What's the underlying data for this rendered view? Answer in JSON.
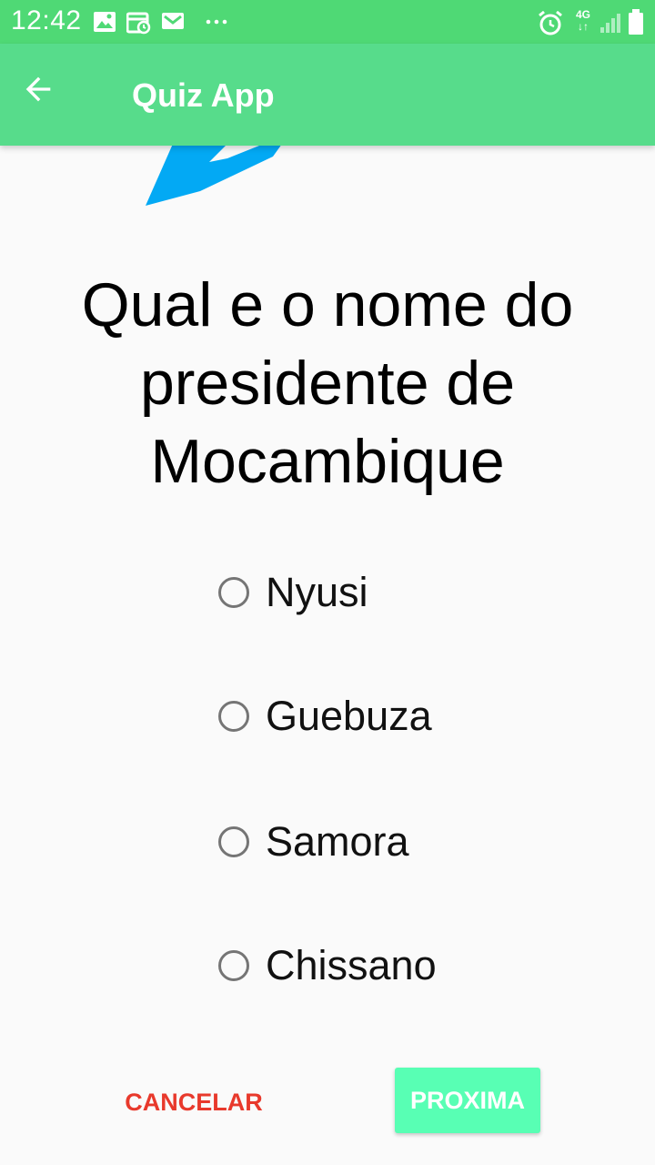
{
  "status_bar": {
    "time": "12:42",
    "left_icons": [
      "image-icon",
      "calendar-icon",
      "gmail-icon",
      "more-dots-icon"
    ],
    "right_icons": [
      "alarm-icon",
      "4g-data-icon",
      "signal-icon",
      "battery-icon"
    ],
    "network_label": "4G"
  },
  "app_bar": {
    "title": "Quiz App",
    "back_icon": "arrow-left-icon",
    "color": "#57dc8b"
  },
  "question": {
    "text": "Qual e o nome do presidente de Mocambique"
  },
  "options": [
    {
      "label": "Nyusi",
      "selected": false
    },
    {
      "label": "Guebuza",
      "selected": false
    },
    {
      "label": "Samora",
      "selected": false
    },
    {
      "label": "Chissano",
      "selected": false
    }
  ],
  "buttons": {
    "cancel_label": "CANCELAR",
    "next_label": "PROXIMA",
    "cancel_color": "#e8392c",
    "next_color": "#58ffb4"
  }
}
